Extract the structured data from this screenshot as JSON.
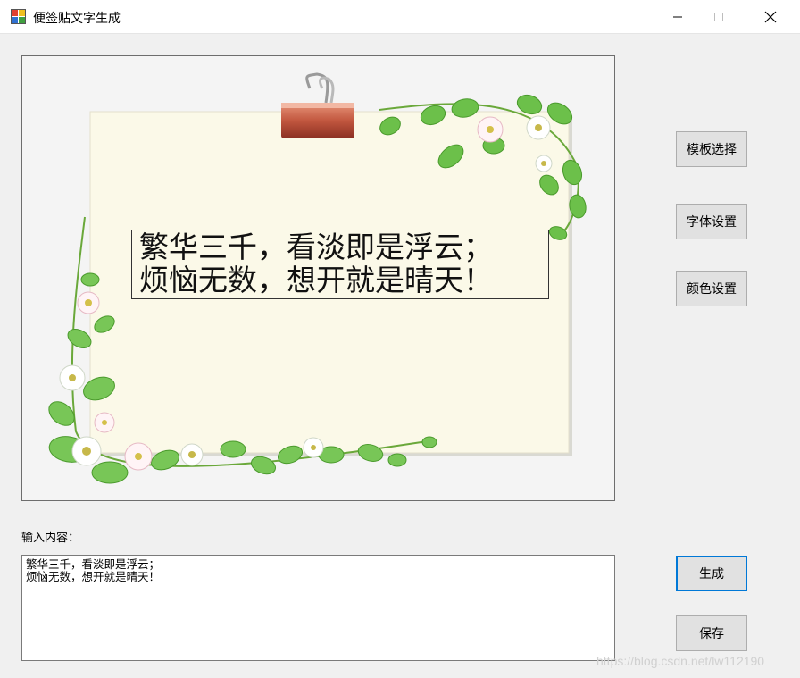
{
  "window": {
    "title": "便签贴文字生成",
    "icon": "app-grid-icon",
    "controls": [
      "minimize-icon",
      "maximize-icon",
      "close-icon"
    ]
  },
  "preview": {
    "text": "繁华三千，看淡即是浮云；\n烦恼无数，想开就是晴天！",
    "colors": {
      "paper": "#fbf9e8",
      "leaf": "#6cc04a",
      "clip": "#c0604a"
    }
  },
  "buttons": {
    "template": "模板选择",
    "font": "字体设置",
    "color": "颜色设置",
    "generate": "生成",
    "save": "保存"
  },
  "input": {
    "label": "输入内容：",
    "value": "繁华三千，看淡即是浮云；\n烦恼无数，想开就是晴天！"
  },
  "watermark": "https://blog.csdn.net/lw112190"
}
